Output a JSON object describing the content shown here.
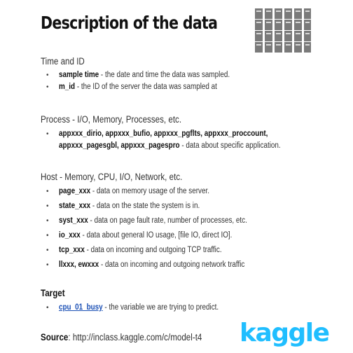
{
  "title": "Description of the data",
  "sections": {
    "time": {
      "heading": "Time and ID",
      "items": [
        {
          "term": "sample time",
          "desc": " - the date and time the data was sampled."
        },
        {
          "term": "m_id",
          "desc": " - the ID of the server the data was sampled at"
        }
      ]
    },
    "process": {
      "heading": "Process - I/O, Memory, Processes, etc.",
      "items": [
        {
          "term_line1": "appxxx_dirio, appxxx_bufio, appxxx_pgflts, appxxx_proccount,",
          "term_line2": "appxxx_pagesgbl, appxxx_pagespro",
          "desc": "  - data about specific application."
        }
      ]
    },
    "host": {
      "heading": "Host - Memory, CPU, I/O, Network, etc.",
      "items": [
        {
          "term": "page_xxx",
          "desc": " - data on memory usage of the server."
        },
        {
          "term": "state_xxx",
          "desc": " - data on the state the system is in."
        },
        {
          "term": "syst_xxx",
          "desc": " - data on page fault rate, number of processes, etc."
        },
        {
          "term": "io_xxx",
          "desc": " - data about general IO usage, [file IO, direct IO]."
        },
        {
          "term": "tcp_xxx",
          "desc": " - data on incoming and outgoing TCP traffic."
        },
        {
          "term": "llxxx, ewxxx",
          "desc": " - data on incoming and outgoing network traffic"
        }
      ]
    },
    "target": {
      "heading": "Target",
      "items": [
        {
          "term": "cpu_01_busy",
          "desc": " - the variable we are trying to predict."
        }
      ]
    }
  },
  "source": {
    "label": "Source",
    "colon": ": ",
    "url": "http://inclass.kaggle.com/c/model-t4"
  },
  "logo": {
    "text": "kaggle",
    "color": "#20beff"
  },
  "icons": {
    "server": "server-rack-icon"
  }
}
